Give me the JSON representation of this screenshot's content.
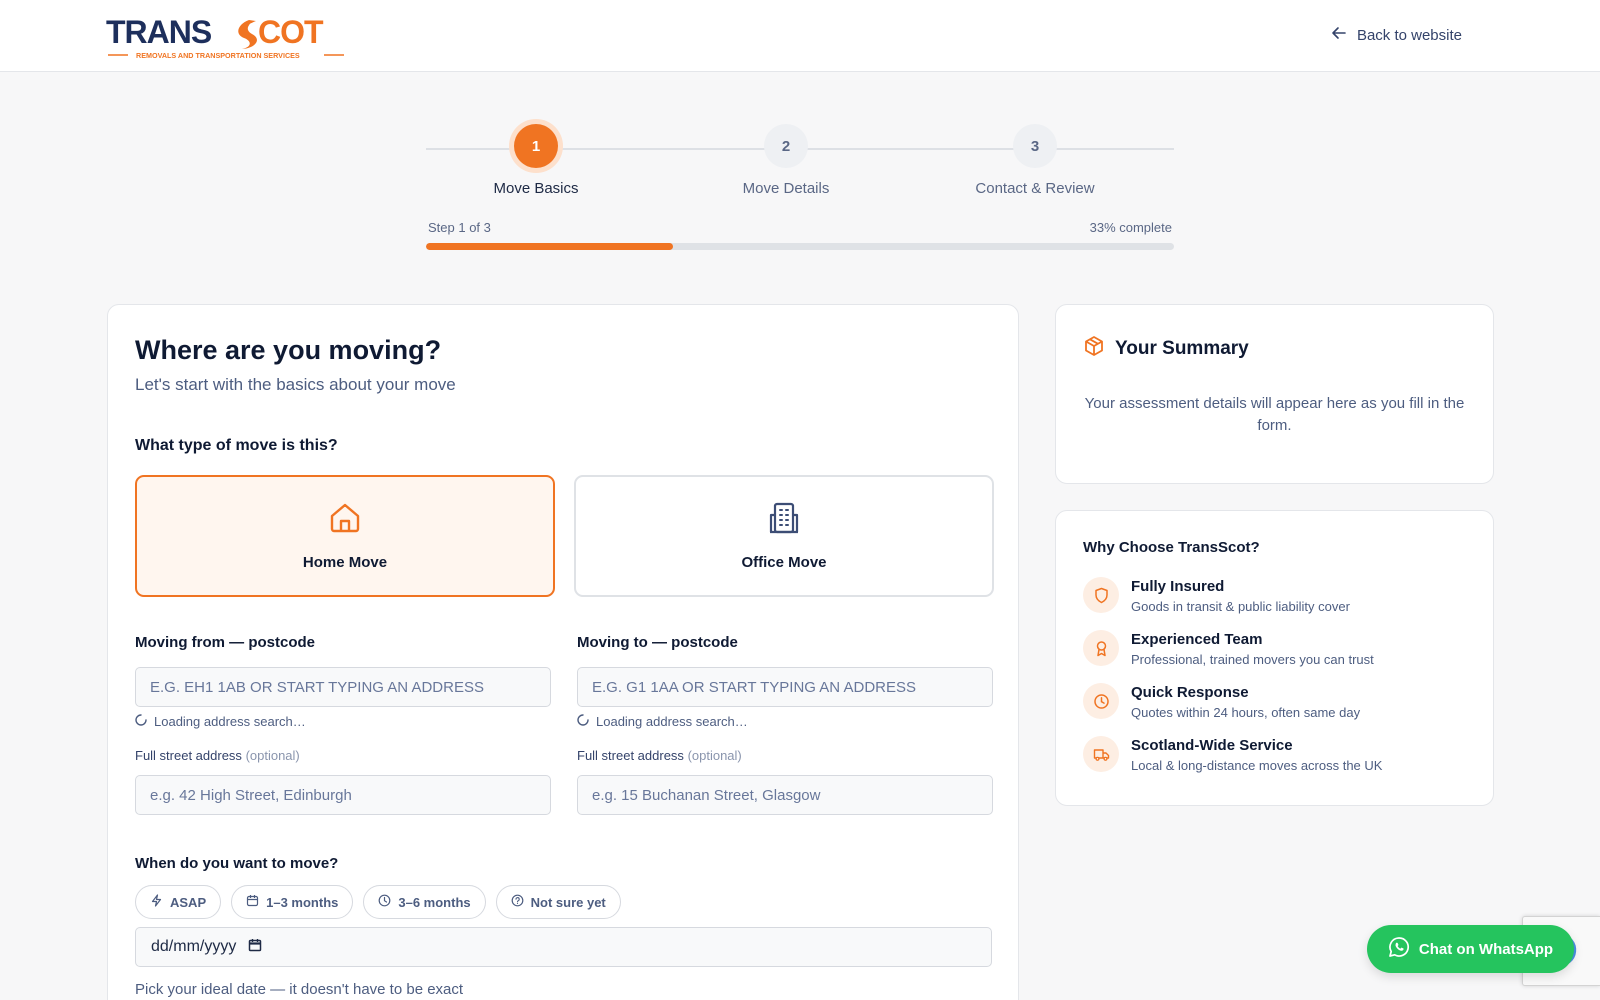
{
  "header": {
    "logo_text": "TRANSCOT",
    "logo_tagline": "REMOVALS AND TRANSPORTATION SERVICES",
    "back_label": "Back to website"
  },
  "stepper": {
    "steps": [
      {
        "number": "1",
        "label": "Move Basics",
        "state": "active"
      },
      {
        "number": "2",
        "label": "Move Details",
        "state": "inactive"
      },
      {
        "number": "3",
        "label": "Contact & Review",
        "state": "inactive"
      }
    ],
    "step_text": "Step 1 of 3",
    "percent_text": "33% complete",
    "progress": 0.33
  },
  "form": {
    "title": "Where are you moving?",
    "subtitle": "Let's start with the basics about your move",
    "move_type_question": "What type of move is this?",
    "move_types": [
      {
        "label": "Home Move",
        "icon": "house-icon",
        "selected": true
      },
      {
        "label": "Office Move",
        "icon": "building-icon",
        "selected": false
      }
    ],
    "from": {
      "label": "Moving from — postcode",
      "placeholder": "E.G. EH1 1AB OR START TYPING AN ADDRESS",
      "loading": "Loading address search…",
      "street_label": "Full street address",
      "street_optional": "(optional)",
      "street_placeholder": "e.g. 42 High Street, Edinburgh"
    },
    "to": {
      "label": "Moving to — postcode",
      "placeholder": "E.G. G1 1AA OR START TYPING AN ADDRESS",
      "loading": "Loading address search…",
      "street_label": "Full street address",
      "street_optional": "(optional)",
      "street_placeholder": "e.g. 15 Buchanan Street, Glasgow"
    },
    "when_question": "When do you want to move?",
    "timing_chips": [
      {
        "label": "ASAP",
        "icon": "lightning-icon"
      },
      {
        "label": "1–3 months",
        "icon": "calendar-icon"
      },
      {
        "label": "3–6 months",
        "icon": "clock-icon"
      },
      {
        "label": "Not sure yet",
        "icon": "question-icon"
      }
    ],
    "date_placeholder": "dd/mm/yyyy",
    "date_hint": "Pick your ideal date — it doesn't have to be exact"
  },
  "summary": {
    "title": "Your Summary",
    "text": "Your assessment details will appear here as you fill in the form."
  },
  "why": {
    "title": "Why Choose TransScot?",
    "items": [
      {
        "title": "Fully Insured",
        "desc": "Goods in transit & public liability cover",
        "icon": "shield-icon"
      },
      {
        "title": "Experienced Team",
        "desc": "Professional, trained movers you can trust",
        "icon": "award-icon"
      },
      {
        "title": "Quick Response",
        "desc": "Quotes within 24 hours, often same day",
        "icon": "clock-icon"
      },
      {
        "title": "Scotland-Wide Service",
        "desc": "Local & long-distance moves across the UK",
        "icon": "truck-icon"
      }
    ]
  },
  "whatsapp": {
    "label": "Chat on WhatsApp"
  },
  "colors": {
    "accent": "#f07422",
    "accent_light": "#fff6ef",
    "navy": "#1e2a45",
    "whatsapp": "#25c45e"
  }
}
